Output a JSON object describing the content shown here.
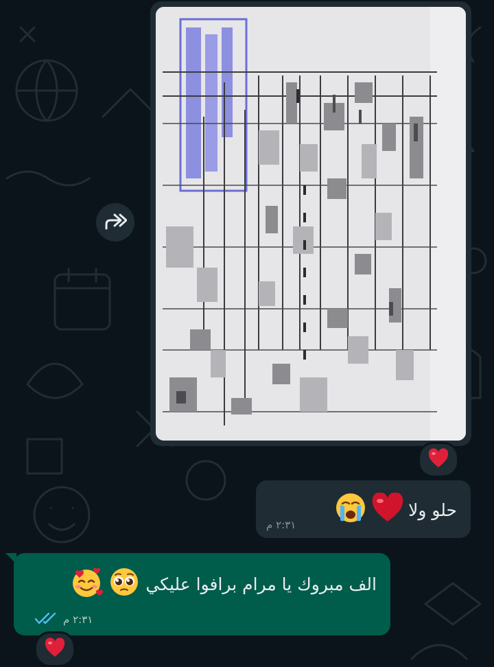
{
  "messages": [
    {
      "type": "image",
      "direction": "incoming",
      "reaction": "heart-emoji"
    },
    {
      "type": "text",
      "direction": "incoming",
      "text": "حلو ولا",
      "emojis": [
        "red-heart-emoji",
        "crying-face-emoji"
      ],
      "time": "٢:٣١ م"
    },
    {
      "type": "text",
      "direction": "outgoing",
      "text": "الف مبروك يا مرام  برافوا عليكي",
      "emojis": [
        "pleading-face-emoji",
        "smiling-face-with-hearts-emoji"
      ],
      "time": "٢:٣١ م",
      "status": "read",
      "reaction": "heart-emoji"
    }
  ],
  "colors": {
    "background": "#0b141a",
    "incoming_bubble": "#1f2c34",
    "outgoing_bubble": "#005c4b",
    "read_ticks": "#53bdeb",
    "heart": "#e0203a"
  }
}
